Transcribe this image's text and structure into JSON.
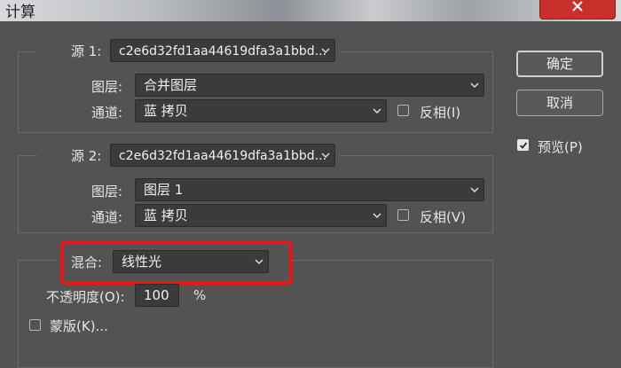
{
  "window": {
    "title": "计算"
  },
  "source1": {
    "label": "源 1:",
    "file": "c2e6d32fd1aa44619dfa3a1bbd...",
    "layer_label": "图层:",
    "layer": "合并图层",
    "channel_label": "通道:",
    "channel": "蓝 拷贝",
    "invert_label": "反相(I)"
  },
  "source2": {
    "label": "源 2:",
    "file": "c2e6d32fd1aa44619dfa3a1bbd...",
    "layer_label": "图层:",
    "layer": "图层 1",
    "channel_label": "通道:",
    "channel": "蓝 拷贝",
    "invert_label": "反相(V)"
  },
  "blend": {
    "label": "混合:",
    "mode": "线性光",
    "opacity_label": "不透明度(O):",
    "opacity": "100",
    "opacity_unit": "%",
    "mask_label": "蒙版(K)..."
  },
  "buttons": {
    "ok": "确定",
    "cancel": "取消"
  },
  "preview": {
    "label": "预览(P)",
    "checked": true
  },
  "colors": {
    "dialog_bg": "#535353",
    "highlight": "#e81818",
    "close": "#c9302c"
  },
  "icons": [
    "close-icon",
    "chevron-down-icon",
    "checkmark-icon"
  ]
}
